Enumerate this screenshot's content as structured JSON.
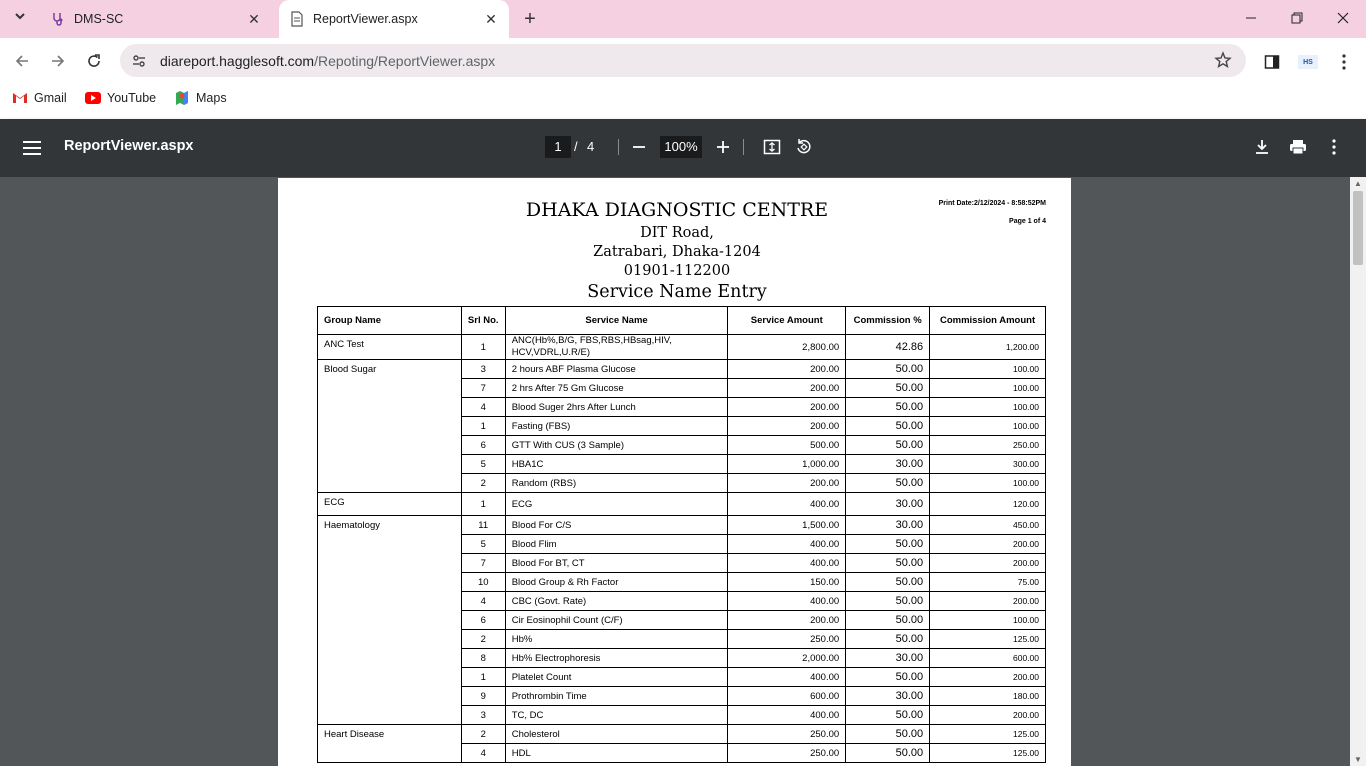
{
  "browser": {
    "tabs": [
      {
        "title": "DMS-SC",
        "active": false
      },
      {
        "title": "ReportViewer.aspx",
        "active": true
      }
    ],
    "url": {
      "host": "diareport.hagglesoft.com",
      "path": "/Repoting/ReportViewer.aspx"
    },
    "bookmarks": [
      {
        "label": "Gmail"
      },
      {
        "label": "YouTube"
      },
      {
        "label": "Maps"
      }
    ]
  },
  "pdf_viewer": {
    "title": "ReportViewer.aspx",
    "current_page": "1",
    "separator": "/",
    "total_pages": "4",
    "zoom": "100%"
  },
  "report": {
    "org_name": "DHAKA DIAGNOSTIC CENTRE",
    "address_line1": "DIT Road,",
    "address_line2": "Zatrabari, Dhaka-1204",
    "phone": "01901-112200",
    "title": "Service Name Entry",
    "print_date": "Print Date:2/12/2024 -  8:58:52PM",
    "page_info": "Page 1 of 4",
    "columns": [
      "Group Name",
      "Srl No.",
      "Service Name",
      "Service Amount",
      "Commission %",
      "Commission Amount"
    ],
    "groups": [
      {
        "name": "ANC Test",
        "rows": [
          {
            "srl": "1",
            "service": "ANC(Hb%,B/G, FBS,RBS,HBsag,HIV, HCV,VDRL,U.R/E)",
            "amount": "2,800.00",
            "pct": "42.86",
            "comm": "1,200.00"
          }
        ]
      },
      {
        "name": "Blood Sugar",
        "rows": [
          {
            "srl": "3",
            "service": "2 hours ABF Plasma Glucose",
            "amount": "200.00",
            "pct": "50.00",
            "comm": "100.00"
          },
          {
            "srl": "7",
            "service": "2 hrs After 75 Gm Glucose",
            "amount": "200.00",
            "pct": "50.00",
            "comm": "100.00"
          },
          {
            "srl": "4",
            "service": "Blood Suger 2hrs After Lunch",
            "amount": "200.00",
            "pct": "50.00",
            "comm": "100.00"
          },
          {
            "srl": "1",
            "service": "Fasting (FBS)",
            "amount": "200.00",
            "pct": "50.00",
            "comm": "100.00"
          },
          {
            "srl": "6",
            "service": "GTT With CUS (3 Sample)",
            "amount": "500.00",
            "pct": "50.00",
            "comm": "250.00"
          },
          {
            "srl": "5",
            "service": "HBA1C",
            "amount": "1,000.00",
            "pct": "30.00",
            "comm": "300.00"
          },
          {
            "srl": "2",
            "service": "Random  (RBS)",
            "amount": "200.00",
            "pct": "50.00",
            "comm": "100.00"
          }
        ]
      },
      {
        "name": "ECG",
        "rows": [
          {
            "srl": "1",
            "service": "ECG",
            "amount": "400.00",
            "pct": "30.00",
            "comm": "120.00"
          }
        ]
      },
      {
        "name": "Haematology",
        "rows": [
          {
            "srl": "11",
            "service": "Blood  For C/S",
            "amount": "1,500.00",
            "pct": "30.00",
            "comm": "450.00"
          },
          {
            "srl": "5",
            "service": "Blood Flim",
            "amount": "400.00",
            "pct": "50.00",
            "comm": "200.00"
          },
          {
            "srl": "7",
            "service": "Blood For BT, CT",
            "amount": "400.00",
            "pct": "50.00",
            "comm": "200.00"
          },
          {
            "srl": "10",
            "service": "Blood Group & Rh Factor",
            "amount": "150.00",
            "pct": "50.00",
            "comm": "75.00"
          },
          {
            "srl": "4",
            "service": "CBC  (Govt. Rate)",
            "amount": "400.00",
            "pct": "50.00",
            "comm": "200.00"
          },
          {
            "srl": "6",
            "service": "Cir Eosinophil Count (C/F)",
            "amount": "200.00",
            "pct": "50.00",
            "comm": "100.00"
          },
          {
            "srl": "2",
            "service": "Hb%",
            "amount": "250.00",
            "pct": "50.00",
            "comm": "125.00"
          },
          {
            "srl": "8",
            "service": "Hb% Electrophoresis",
            "amount": "2,000.00",
            "pct": "30.00",
            "comm": "600.00"
          },
          {
            "srl": "1",
            "service": "Platelet Count",
            "amount": "400.00",
            "pct": "50.00",
            "comm": "200.00"
          },
          {
            "srl": "9",
            "service": "Prothrombin Time",
            "amount": "600.00",
            "pct": "30.00",
            "comm": "180.00"
          },
          {
            "srl": "3",
            "service": "TC, DC",
            "amount": "400.00",
            "pct": "50.00",
            "comm": "200.00"
          }
        ]
      },
      {
        "name": "Heart Disease",
        "rows": [
          {
            "srl": "2",
            "service": "Cholesterol",
            "amount": "250.00",
            "pct": "50.00",
            "comm": "125.00"
          },
          {
            "srl": "4",
            "service": "HDL",
            "amount": "250.00",
            "pct": "50.00",
            "comm": "125.00"
          }
        ]
      }
    ]
  }
}
